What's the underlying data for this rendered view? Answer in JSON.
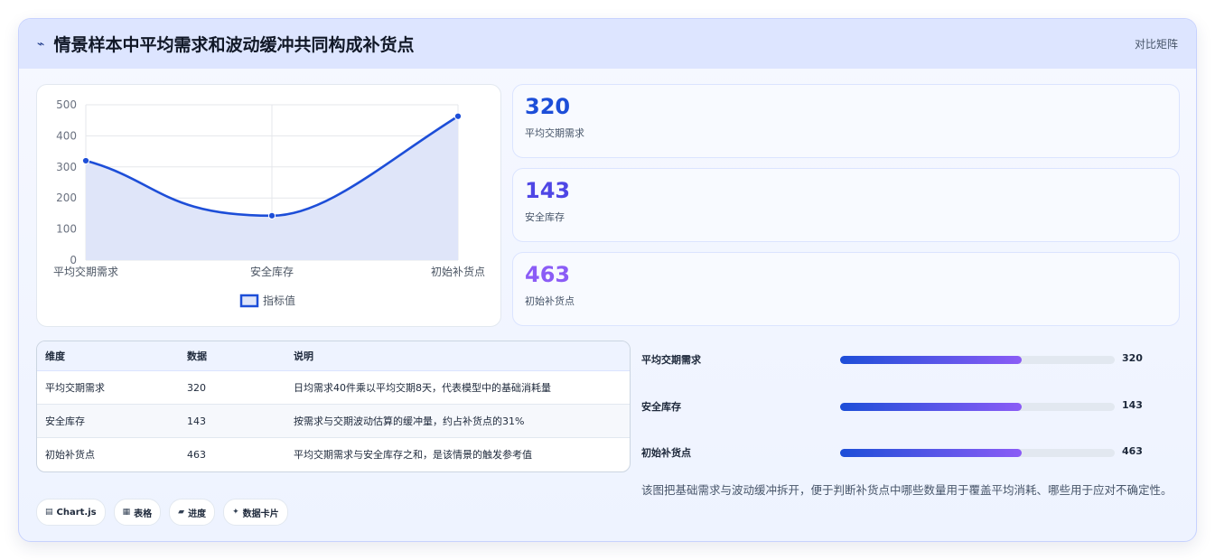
{
  "header": {
    "icon": "wave-icon",
    "title": "情景样本中平均需求和波动缓冲共同构成补货点",
    "right_label": "对比矩阵"
  },
  "colors": {
    "line": "#1d4ed8",
    "area": "#dfe5f9",
    "stat_1": "#1d4ed8",
    "stat_2": "#4f46e5",
    "stat_3": "#8b5cf6"
  },
  "chart_data": {
    "type": "line",
    "categories": [
      "平均交期需求",
      "安全库存",
      "初始补货点"
    ],
    "series": [
      {
        "name": "指标值",
        "values": [
          320,
          143,
          463
        ]
      }
    ],
    "ylim": [
      0,
      500
    ],
    "yticks": [
      0,
      100,
      200,
      300,
      400,
      500
    ],
    "fill": true,
    "grid": true,
    "legend_position": "bottom"
  },
  "stats": [
    {
      "value": "320",
      "label": "平均交期需求"
    },
    {
      "value": "143",
      "label": "安全库存"
    },
    {
      "value": "463",
      "label": "初始补货点"
    }
  ],
  "table": {
    "headers": [
      "维度",
      "数据",
      "说明"
    ],
    "rows": [
      [
        "平均交期需求",
        "320",
        "日均需求40件乘以平均交期8天，代表模型中的基础消耗量"
      ],
      [
        "安全库存",
        "143",
        "按需求与交期波动估算的缓冲量，约占补货点的31%"
      ],
      [
        "初始补货点",
        "463",
        "平均交期需求与安全库存之和，是该情景的触发参考值"
      ]
    ]
  },
  "bars": [
    {
      "label": "平均交期需求",
      "value": "320",
      "fill_fraction": 0.66
    },
    {
      "label": "安全库存",
      "value": "143",
      "fill_fraction": 0.66
    },
    {
      "label": "初始补货点",
      "value": "463",
      "fill_fraction": 0.66
    }
  ],
  "note": "该图把基础需求与波动缓冲拆开，便于判断补货点中哪些数量用于覆盖平均消耗、哪些用于应对不确定性。",
  "chips": [
    {
      "icon": "chart-icon",
      "glyph": "▤",
      "label": "Chart.js"
    },
    {
      "icon": "table-icon",
      "glyph": "▦",
      "label": "表格"
    },
    {
      "icon": "progress-icon",
      "glyph": "▰",
      "label": "进度"
    },
    {
      "icon": "sparkle-icon",
      "glyph": "✦",
      "label": "数据卡片"
    }
  ]
}
